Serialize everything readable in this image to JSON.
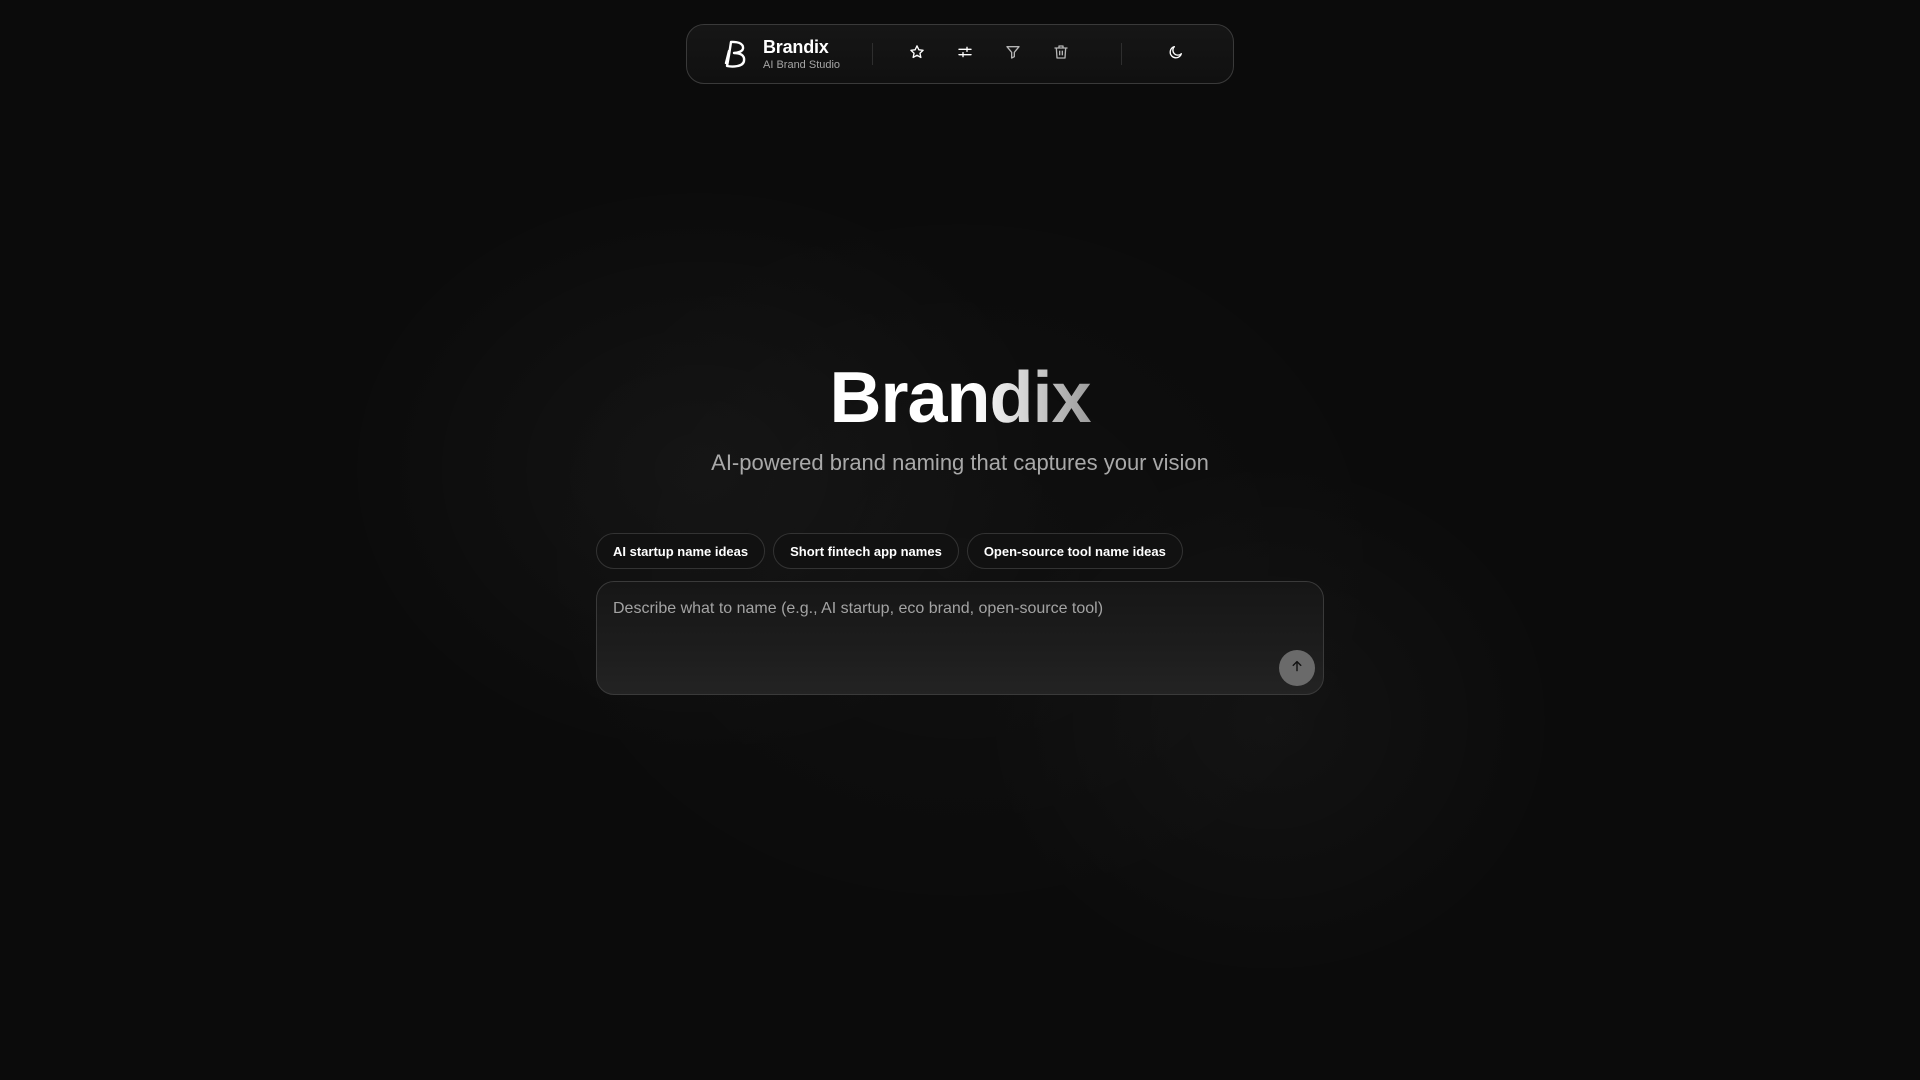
{
  "app": {
    "name": "Brandix",
    "subtitle": "AI Brand Studio"
  },
  "toolbar": {
    "icons": [
      "star-icon",
      "sliders-icon",
      "filter-icon",
      "trash-icon"
    ],
    "theme_icon": "moon-icon"
  },
  "hero": {
    "title": "Brandix",
    "tagline": "AI-powered brand naming that captures your vision"
  },
  "suggestions": [
    "AI startup name ideas",
    "Short fintech app names",
    "Open-source tool name ideas"
  ],
  "prompt": {
    "placeholder": "Describe what to name (e.g., AI startup, eco brand, open-source tool)",
    "value": "",
    "send_icon": "arrow-up-icon"
  },
  "colors": {
    "background": "#0b0b0b",
    "border": "#3a3a3a",
    "muted_text": "#a9a9a9",
    "send_button": "#6a6a6a"
  }
}
